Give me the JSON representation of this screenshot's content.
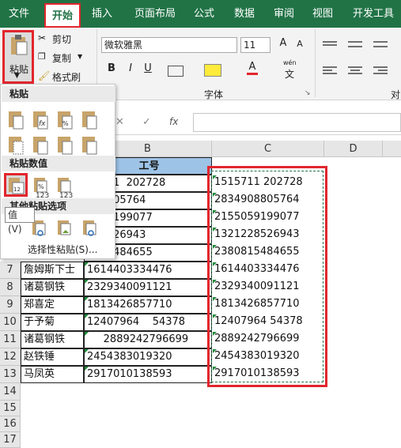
{
  "ribbon_tabs": [
    "文件",
    "开始",
    "插入",
    "页面布局",
    "公式",
    "数据",
    "审阅",
    "视图",
    "开发工具"
  ],
  "clipboard": {
    "paste": "粘贴",
    "cut": "剪切",
    "copy": "复制",
    "format_painter": "格式刷"
  },
  "font": {
    "name": "微软雅黑",
    "size": "11",
    "group_label": "字体",
    "wen": "wén",
    "wen2": "文",
    "bold": "B",
    "italic": "I",
    "underline": "U",
    "grow": "A",
    "shrink": "A",
    "color_a": "A"
  },
  "align_group_label": "对",
  "formula_bar": {
    "fx": "fx",
    "cancel": "✕",
    "enter": "✓"
  },
  "columns": [
    "B",
    "C",
    "D"
  ],
  "rows": [
    "7",
    "8",
    "9",
    "10",
    "11",
    "12",
    "13",
    "14",
    "15",
    "16",
    "17"
  ],
  "header_cell": "工号",
  "col_a": [
    "詹姆斯下士",
    "诸葛钢铁",
    "郑喜定",
    "于予菊",
    "诸葛钢铁",
    "赵铁锤",
    "马凤英"
  ],
  "col_b": [
    "15711  202728",
    "908805764",
    "5059199077",
    "228526943",
    "0815484655",
    "1614403334476",
    "2329340091121",
    "1813426857710",
    "12407964    54378",
    "     2889242796699",
    "2454383019320",
    "2917010138593"
  ],
  "col_c": [
    "1515711 202728",
    "2834908805764",
    "2155059199077",
    "1321228526943",
    "2380815484655",
    "1614403334476",
    "2329340091121",
    "1813426857710",
    "12407964 54378",
    "2889242796699",
    "2454383019320",
    "2917010138593"
  ],
  "paste_menu": {
    "h1": "粘贴",
    "h2": "粘贴数值",
    "h3": "其他粘贴选项",
    "special": "选择性粘贴(S)...",
    "tooltip": "值 (V)",
    "v123": "123"
  }
}
